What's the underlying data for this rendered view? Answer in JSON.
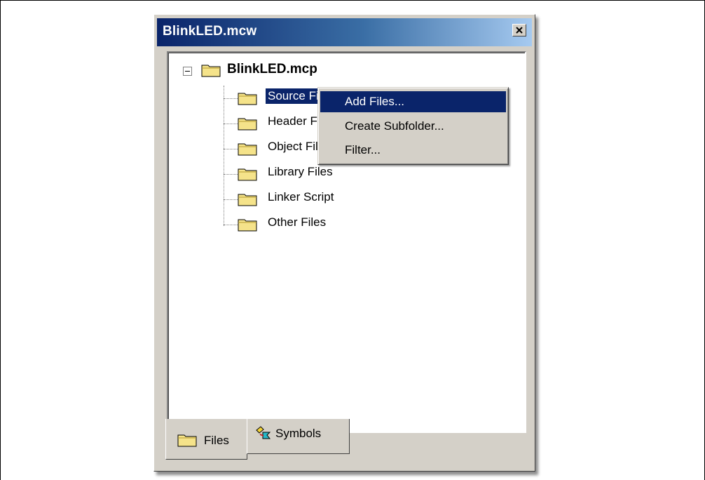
{
  "window": {
    "title": "BlinkLED.mcw",
    "close_glyph": "x"
  },
  "tree": {
    "root": {
      "label": "BlinkLED.mcp",
      "expanded": true,
      "expander_glyph": "−"
    },
    "children": [
      {
        "label": "Source Fi",
        "selected": true
      },
      {
        "label": "Header Fi",
        "selected": false
      },
      {
        "label": "Object Fil",
        "selected": false
      },
      {
        "label": "Library Files",
        "selected": false
      },
      {
        "label": "Linker Script",
        "selected": false
      },
      {
        "label": "Other Files",
        "selected": false
      }
    ]
  },
  "context_menu": {
    "items": [
      {
        "label": "Add Files...",
        "active": true
      },
      {
        "label": "Create Subfolder...",
        "active": false
      },
      {
        "label": "Filter...",
        "active": false
      }
    ]
  },
  "tabs": [
    {
      "label": "Files",
      "icon": "folder-icon",
      "selected": true
    },
    {
      "label": "Symbols",
      "icon": "symbols-icon",
      "selected": false
    }
  ],
  "colors": {
    "selection": "#0a246a",
    "window_face": "#d4d0c8",
    "folder_fill": "#f5e38a"
  }
}
